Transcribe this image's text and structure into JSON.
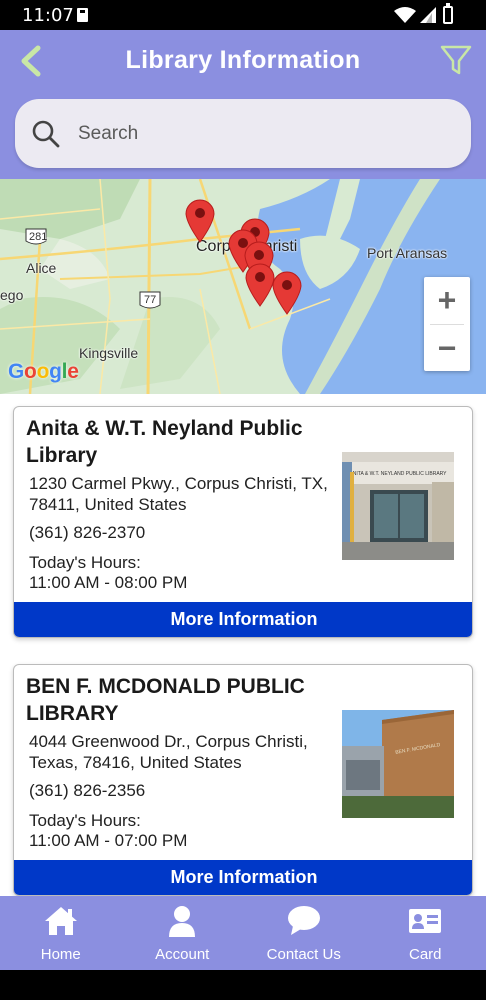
{
  "status_bar": {
    "time": "11:07"
  },
  "header": {
    "title": "Library Information",
    "search_placeholder": "Search"
  },
  "map": {
    "labels": {
      "corpus_christi": "Corpus Christi",
      "port_aransas": "Port Aransas",
      "alice": "Alice",
      "kingsville": "Kingsville",
      "ego": "ego",
      "hwy_281": "281",
      "hwy_77": "77"
    },
    "zoom_in": "+",
    "zoom_out": "−",
    "attribution": "Google",
    "pin_color": "#e53935"
  },
  "libraries": [
    {
      "name": "Anita & W.T. Neyland Public Library",
      "address": "1230 Carmel Pkwy., Corpus Christi, TX, 78411, United States",
      "phone": "(361) 826-2370",
      "hours_label": "Today's Hours:",
      "hours": "11:00 AM - 08:00 PM",
      "photo_sign": "ANITA AND W.T. NEYLAND PUBLIC LIBRARY",
      "button": "More Information"
    },
    {
      "name": "BEN F. MCDONALD PUBLIC LIBRARY",
      "address": "4044 Greenwood Dr., Corpus Christi, Texas, 78416, United States",
      "phone": "(361) 826-2356",
      "hours_label": "Today's Hours:",
      "hours": "11:00 AM - 07:00 PM",
      "photo_sign": "BEN F. MCDONALD PUBLIC LIBRARY",
      "button": "More Information"
    }
  ],
  "nav": [
    {
      "label": "Home",
      "icon": "home-icon"
    },
    {
      "label": "Account",
      "icon": "account-icon"
    },
    {
      "label": "Contact Us",
      "icon": "chat-icon"
    },
    {
      "label": "Card",
      "icon": "card-icon"
    }
  ],
  "colors": {
    "header": "#8b8fe0",
    "button": "#0038c8",
    "pin": "#e53935"
  }
}
